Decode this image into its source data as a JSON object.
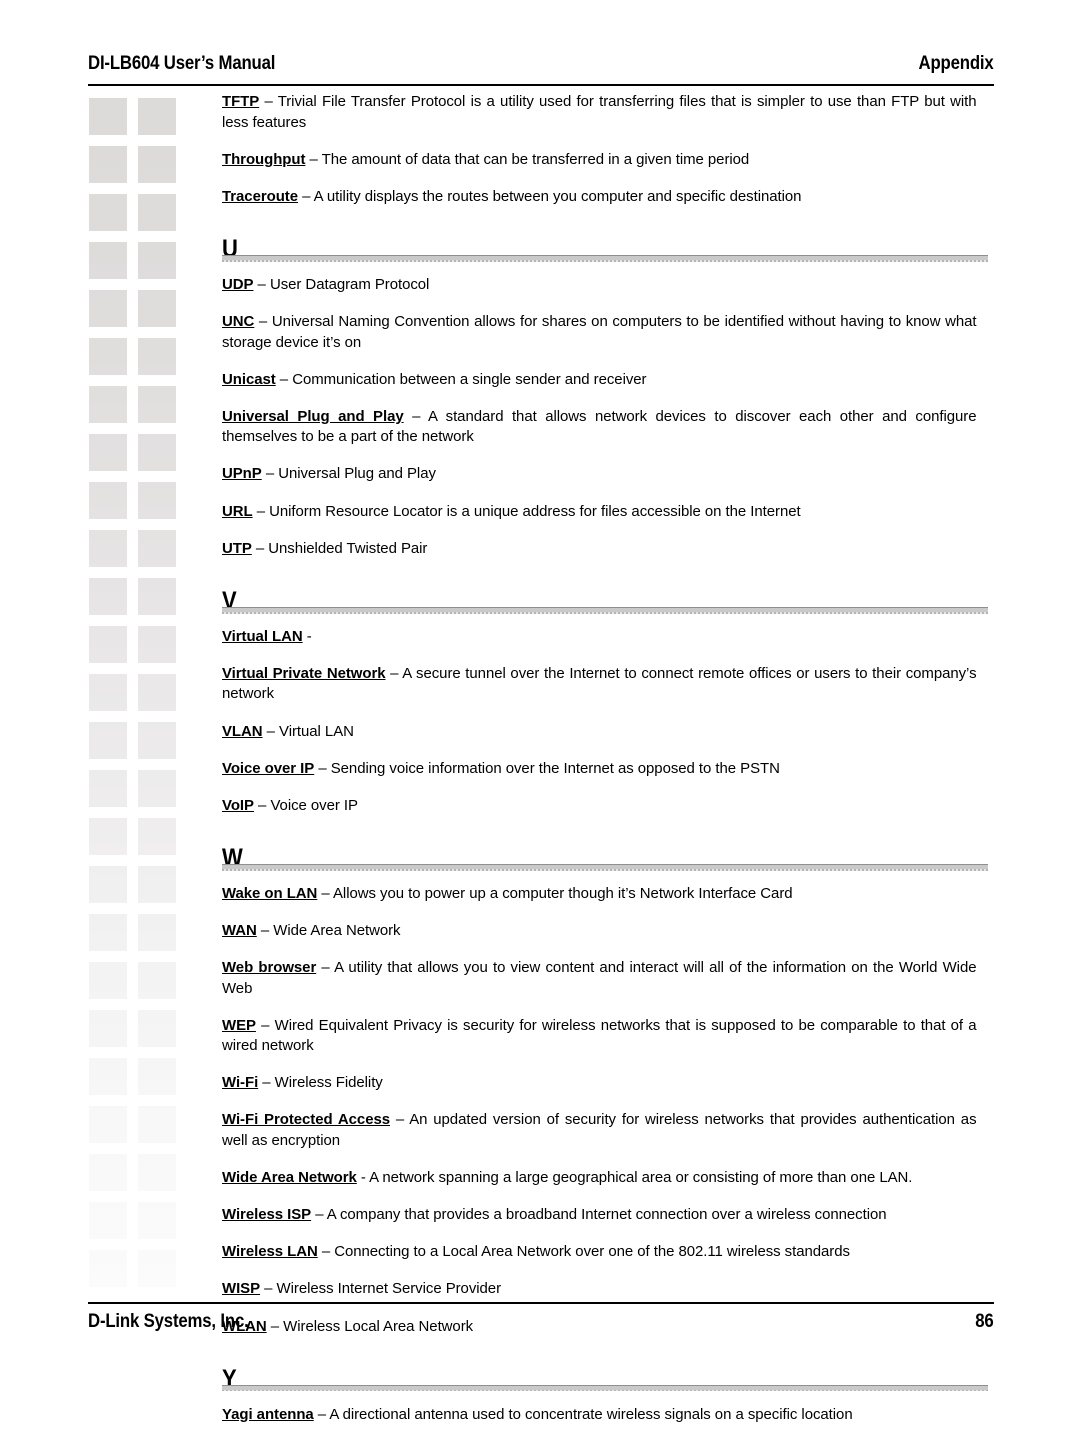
{
  "header": {
    "left": "DI-LB604 User’s Manual",
    "right": "Appendix"
  },
  "footer": {
    "left": "D-Link Systems, Inc.",
    "page_number": "86"
  },
  "decoration": {
    "square_color": "#dddada",
    "columns": 2,
    "rows": 25
  },
  "body": [
    {
      "kind": "entry",
      "term": "TFTP",
      "separator": " – ",
      "definition": "Trivial File Transfer Protocol is a utility used for transferring files that is simpler to use than FTP but with less features"
    },
    {
      "kind": "entry",
      "term": "Throughput",
      "separator": " – ",
      "definition": "The amount of data that can be transferred in a given time period"
    },
    {
      "kind": "entry",
      "term": "Traceroute",
      "separator": " – ",
      "definition": "A utility displays the routes between you computer and specific destination"
    },
    {
      "kind": "section",
      "letter": "U"
    },
    {
      "kind": "entry",
      "term": "UDP",
      "separator": " – ",
      "definition": "User Datagram Protocol"
    },
    {
      "kind": "entry",
      "term": "UNC",
      "separator": " – ",
      "definition": "Universal Naming Convention allows for shares on computers to be identified without having to know what storage device it’s on"
    },
    {
      "kind": "entry",
      "term": "Unicast",
      "separator": " – ",
      "definition": "Communication between a single sender and receiver"
    },
    {
      "kind": "entry",
      "term": "Universal Plug and Play",
      "separator": " – ",
      "definition": "A standard that allows network devices to discover each other and configure themselves to be a part of the network"
    },
    {
      "kind": "entry",
      "term": "UPnP",
      "separator": " – ",
      "definition": "Universal Plug and Play"
    },
    {
      "kind": "entry",
      "term": "URL",
      "separator": " – ",
      "definition": "Uniform Resource Locator is a unique address for files accessible on the Internet"
    },
    {
      "kind": "entry",
      "term": "UTP",
      "separator": " – ",
      "definition": "Unshielded Twisted Pair"
    },
    {
      "kind": "section",
      "letter": "V"
    },
    {
      "kind": "entry",
      "term": "Virtual LAN",
      "separator": " -",
      "definition": ""
    },
    {
      "kind": "entry",
      "term": "Virtual Private Network",
      "separator": " – ",
      "definition": "A secure tunnel over the Internet to connect remote offices or users to their company’s network"
    },
    {
      "kind": "entry",
      "term": "VLAN",
      "separator": " – ",
      "definition": "Virtual LAN"
    },
    {
      "kind": "entry",
      "term": "Voice over IP",
      "separator": " – ",
      "definition": "Sending voice information over the Internet as opposed to the PSTN"
    },
    {
      "kind": "entry",
      "term": "VoIP",
      "separator": " – ",
      "definition": "Voice over IP"
    },
    {
      "kind": "section",
      "letter": "W"
    },
    {
      "kind": "entry",
      "term": "Wake on LAN",
      "separator": " – ",
      "definition": "Allows you to power up a computer though it’s Network Interface Card"
    },
    {
      "kind": "entry",
      "term": "WAN",
      "separator": " – ",
      "definition": "Wide Area Network"
    },
    {
      "kind": "entry",
      "term": "Web browser",
      "separator": " – ",
      "definition": "A utility that allows you to view content and interact will all of the information on the World Wide Web"
    },
    {
      "kind": "entry",
      "term": "WEP",
      "separator": " – ",
      "definition": "Wired Equivalent Privacy is security for wireless networks that is supposed  to be comparable to that of a wired network"
    },
    {
      "kind": "entry",
      "term": "Wi-Fi",
      "separator": " – ",
      "definition": "Wireless Fidelity"
    },
    {
      "kind": "entry",
      "term": "Wi-Fi Protected Access",
      "separator": " – ",
      "definition": "An updated version of security for wireless networks that provides authentication as well as encryption"
    },
    {
      "kind": "entry",
      "term": "Wide Area Network",
      "separator": " - ",
      "definition": "A network spanning a large geographical area or consisting of more than one LAN."
    },
    {
      "kind": "entry",
      "term": "Wireless ISP",
      "separator": " – ",
      "definition": "A company that provides a broadband Internet connection over a wireless connection"
    },
    {
      "kind": "entry",
      "term": "Wireless LAN",
      "separator": " – ",
      "definition": "Connecting to a Local Area Network over one of the 802.11 wireless standards"
    },
    {
      "kind": "entry",
      "term": "WISP",
      "separator": " – ",
      "definition": "Wireless Internet Service Provider"
    },
    {
      "kind": "entry",
      "term": "WLAN",
      "separator": " – ",
      "definition": "Wireless Local Area Network"
    },
    {
      "kind": "section",
      "letter": "Y"
    },
    {
      "kind": "entry",
      "term": "Yagi antenna",
      "separator": " – ",
      "definition": "A directional antenna used to concentrate wireless signals on a specific location"
    }
  ]
}
